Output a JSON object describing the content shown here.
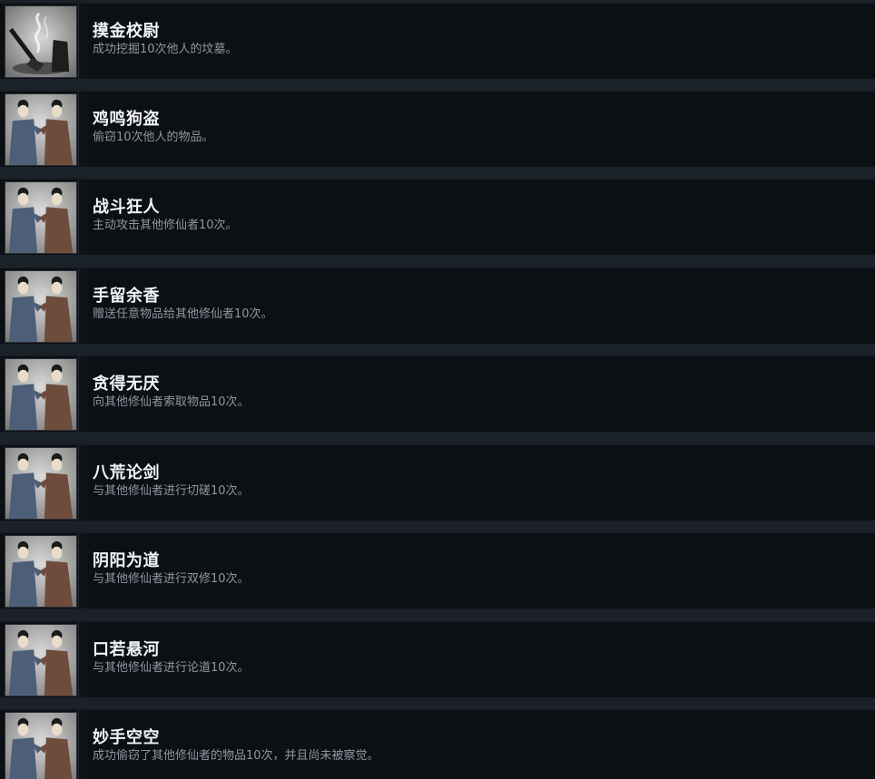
{
  "achievements": [
    {
      "title": "摸金校尉",
      "description": "成功挖掘10次他人的坟墓。",
      "icon": "grave-digging-icon"
    },
    {
      "title": "鸡鸣狗盗",
      "description": "偷窃10次他人的物品。",
      "icon": "cultivators-greeting-icon"
    },
    {
      "title": "战斗狂人",
      "description": "主动攻击其他修仙者10次。",
      "icon": "cultivators-greeting-icon"
    },
    {
      "title": "手留余香",
      "description": "赠送任意物品给其他修仙者10次。",
      "icon": "cultivators-greeting-icon"
    },
    {
      "title": "贪得无厌",
      "description": "向其他修仙者索取物品10次。",
      "icon": "cultivators-greeting-icon"
    },
    {
      "title": "八荒论剑",
      "description": "与其他修仙者进行切磋10次。",
      "icon": "cultivators-greeting-icon"
    },
    {
      "title": "阴阳为道",
      "description": "与其他修仙者进行双修10次。",
      "icon": "cultivators-greeting-icon"
    },
    {
      "title": "口若悬河",
      "description": "与其他修仙者进行论道10次。",
      "icon": "cultivators-greeting-icon"
    },
    {
      "title": "妙手空空",
      "description": "成功偷窃了其他修仙者的物品10次，并且尚未被察觉。",
      "icon": "cultivators-greeting-icon"
    }
  ]
}
